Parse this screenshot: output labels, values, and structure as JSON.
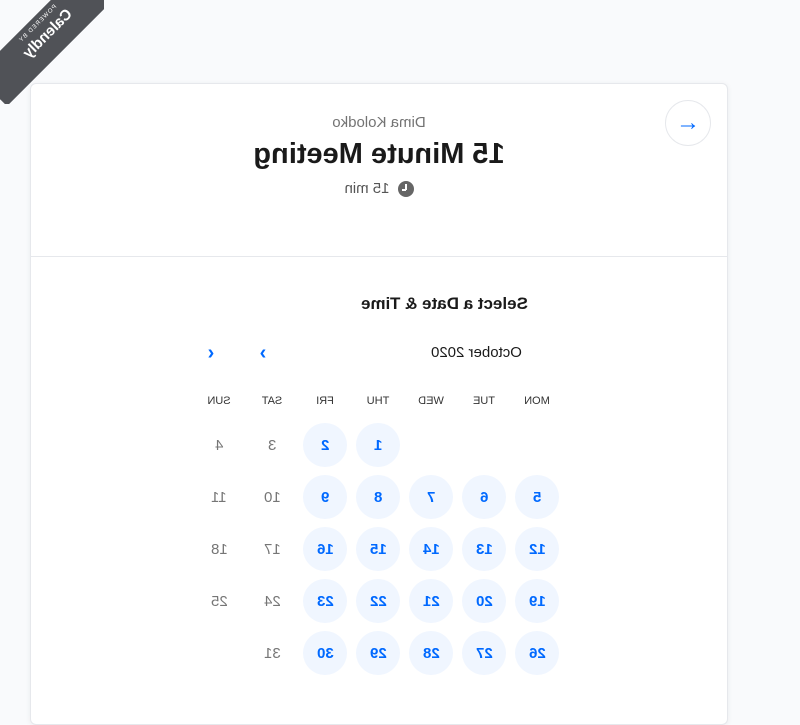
{
  "badge": {
    "small": "POWERED BY",
    "brand": "Calendly"
  },
  "header": {
    "owner": "Dima Kolodko",
    "title": "15 Minute Meeting",
    "duration": "15 min",
    "next_icon": "arrow-right-icon"
  },
  "scheduler": {
    "section_title": "Select a Date & Time",
    "month": "October 2020",
    "prev_icon": "chevron-left-icon",
    "next_icon": "chevron-right-icon",
    "weekdays": [
      "MON",
      "TUE",
      "WED",
      "THU",
      "FRI",
      "SAT",
      "SUN"
    ],
    "days": [
      {
        "day": "1",
        "available": true
      },
      {
        "day": "2",
        "available": true
      },
      {
        "day": "3",
        "available": false
      },
      {
        "day": "4",
        "available": false
      },
      {
        "day": "5",
        "available": true
      },
      {
        "day": "6",
        "available": true
      },
      {
        "day": "7",
        "available": true
      },
      {
        "day": "8",
        "available": true
      },
      {
        "day": "9",
        "available": true
      },
      {
        "day": "10",
        "available": false
      },
      {
        "day": "11",
        "available": false
      },
      {
        "day": "12",
        "available": true
      },
      {
        "day": "13",
        "available": true
      },
      {
        "day": "14",
        "available": true
      },
      {
        "day": "15",
        "available": true
      },
      {
        "day": "16",
        "available": true
      },
      {
        "day": "17",
        "available": false
      },
      {
        "day": "18",
        "available": false
      },
      {
        "day": "19",
        "available": true
      },
      {
        "day": "20",
        "available": true
      },
      {
        "day": "21",
        "available": true
      },
      {
        "day": "22",
        "available": true
      },
      {
        "day": "23",
        "available": true
      },
      {
        "day": "24",
        "available": false
      },
      {
        "day": "25",
        "available": false
      },
      {
        "day": "26",
        "available": true
      },
      {
        "day": "27",
        "available": true
      },
      {
        "day": "28",
        "available": true
      },
      {
        "day": "29",
        "available": true
      },
      {
        "day": "30",
        "available": true
      },
      {
        "day": "31",
        "available": false
      }
    ],
    "first_weekday_index": 3
  },
  "colors": {
    "accent": "#0069ff",
    "available_bg": "#f0f6ff",
    "badge_bg": "#505257"
  }
}
